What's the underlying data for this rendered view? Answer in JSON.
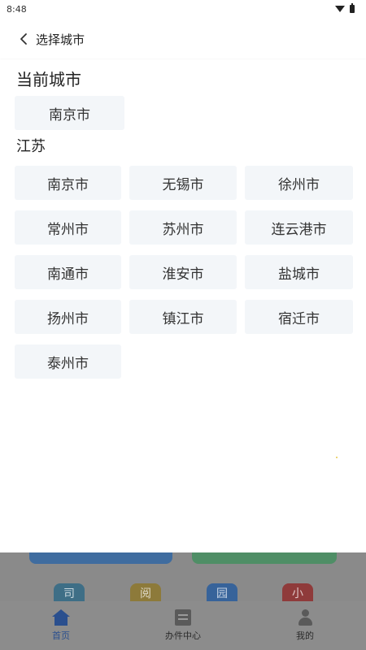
{
  "status": {
    "time": "8:48"
  },
  "header": {
    "title": "选择城市"
  },
  "current": {
    "label": "当前城市",
    "city": "南京市"
  },
  "province": {
    "label": "江苏",
    "cities": [
      "南京市",
      "无锡市",
      "徐州市",
      "常州市",
      "苏州市",
      "连云港市",
      "南通市",
      "淮安市",
      "盐城市",
      "扬州市",
      "镇江市",
      "宿迁市",
      "泰州市"
    ]
  },
  "background": {
    "tiles": [
      "司",
      "阅",
      "园",
      "小"
    ]
  },
  "tabbar": {
    "items": [
      {
        "label": "首页",
        "icon": "home-icon",
        "active": true
      },
      {
        "label": "办件中心",
        "icon": "document-icon",
        "active": false
      },
      {
        "label": "我的",
        "icon": "user-icon",
        "active": false
      }
    ]
  }
}
